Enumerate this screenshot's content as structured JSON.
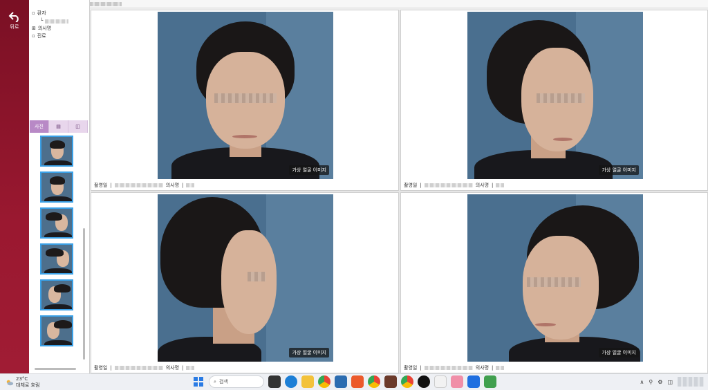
{
  "rail": {
    "back_label": "뒤로"
  },
  "window": {
    "title_prefix": "■"
  },
  "tree": {
    "items": [
      {
        "label": "환자"
      },
      {
        "label": "",
        "sub": true
      },
      {
        "label": "의사명"
      },
      {
        "label": "진료"
      }
    ]
  },
  "tabs": [
    {
      "label": "사진",
      "active": true
    },
    {
      "label": "▤",
      "active": false
    },
    {
      "label": "◫",
      "active": false
    }
  ],
  "thumbnails": [
    "front",
    "front",
    "right-profile",
    "right-side",
    "left-side",
    "left-profile"
  ],
  "cells": [
    {
      "caption": "가상 얼굴 이미지",
      "info_left": "촬영일",
      "info_mid": "의사명"
    },
    {
      "caption": "가상 얼굴 이미지",
      "info_left": "촬영일",
      "info_mid": "의사명"
    },
    {
      "caption": "가상 얼굴 이미지",
      "info_left": "촬영일",
      "info_mid": "의사명"
    },
    {
      "caption": "가상 얼굴 이미지",
      "info_left": "촬영일",
      "info_mid": "의사명"
    }
  ],
  "taskbar": {
    "weather_temp": "23°C",
    "weather_desc": "대체로 흐림",
    "search_placeholder": "검색"
  },
  "colors": {
    "rail": "#8e1530",
    "accent_tab": "#b889c6",
    "thumb_border": "#3aa0e6",
    "photo_bg": "#4a6f8f"
  }
}
